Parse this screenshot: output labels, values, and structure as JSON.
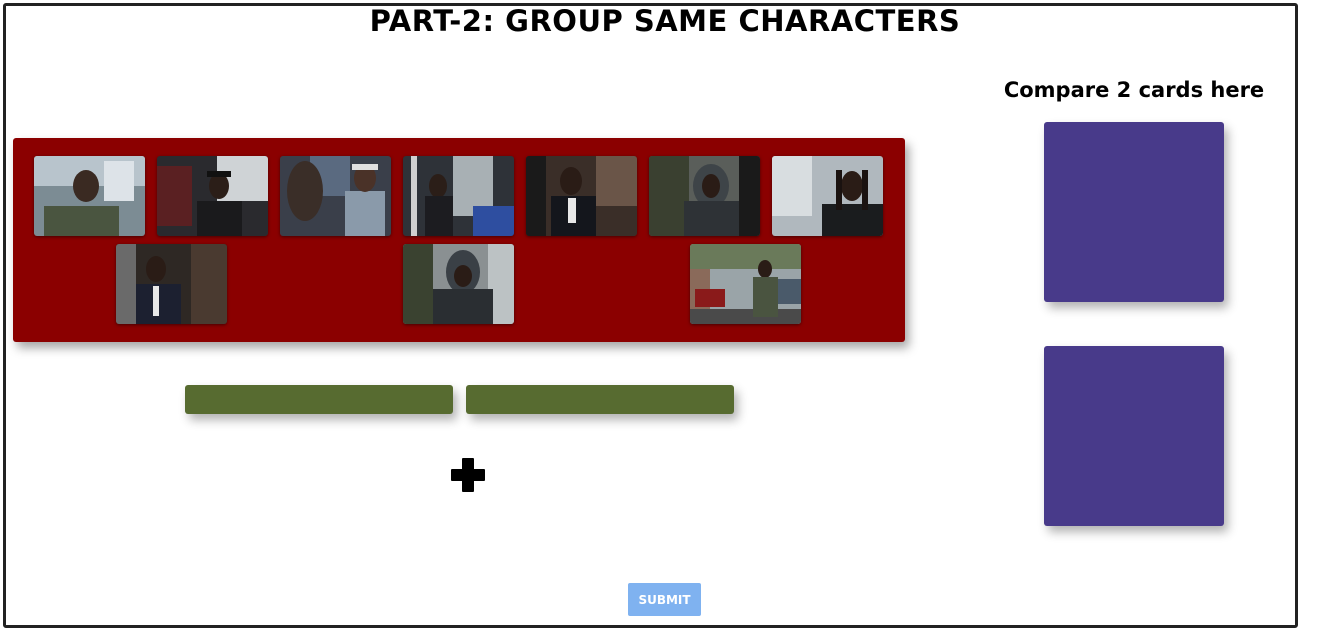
{
  "page": {
    "title": "PART-2: GROUP SAME CHARACTERS",
    "compare_label": "Compare 2 cards here",
    "submit_label": "SUBMIT",
    "add_group_icon": "plus-icon"
  },
  "colors": {
    "pool_bg": "#8b0000",
    "group_box": "#576b30",
    "compare_slot": "#483a8a",
    "submit_bg": "#7fb2f0",
    "frame_border": "#222222"
  },
  "cards": [
    {
      "scene": "man in green shirt indoors"
    },
    {
      "scene": "man in black cap on bus"
    },
    {
      "scene": "two men, one in denim vest"
    },
    {
      "scene": "man seated on bus"
    },
    {
      "scene": "man in suit"
    },
    {
      "scene": "man in grey hoodie"
    },
    {
      "scene": "man with dreadlocks"
    },
    {
      "scene": "man in suit facing another"
    },
    {
      "scene": "man in hood looking down"
    },
    {
      "scene": "man in green jacket on street"
    }
  ],
  "groups": [
    {},
    {}
  ],
  "compare_slots": [
    {},
    {}
  ]
}
